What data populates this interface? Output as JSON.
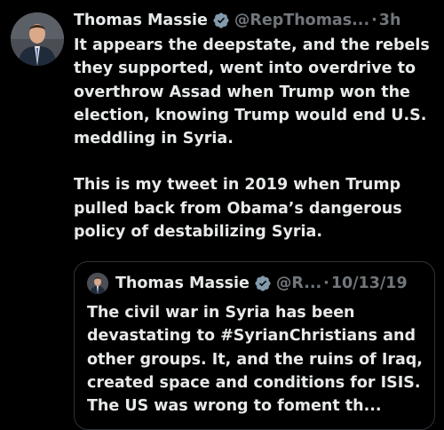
{
  "tweet": {
    "author_name": "Thomas Massie",
    "handle": "@RepThomas...",
    "separator": "·",
    "time": "3h",
    "paragraphs": [
      "It appears the deepstate, and the rebels they supported, went into overdrive to overthrow Assad when Trump won the election, knowing Trump would end U.S. meddling in Syria.",
      "This is my tweet in 2019 when Trump pulled back from Obama’s dangerous policy of destabilizing Syria."
    ]
  },
  "quoted_tweet": {
    "author_name": "Thomas Massie",
    "handle": "@R...",
    "separator": "·",
    "time": "10/13/19",
    "text": "The civil war in Syria has been devastating to #SyrianChristians and other groups. It, and the ruins of Iraq, created space and conditions for ISIS. The US was wrong to foment th..."
  },
  "colors": {
    "background": "#000000",
    "text": "#e7e9ea",
    "secondary_text": "#71767b",
    "verified_badge": "#829aab",
    "quote_border": "#2f3336"
  },
  "icons": [
    "avatar",
    "verified-badge-icon"
  ]
}
